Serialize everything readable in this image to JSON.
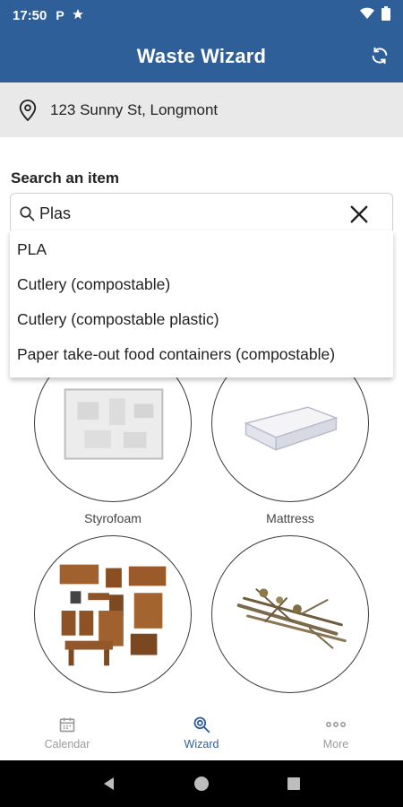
{
  "status_bar": {
    "time": "17:50",
    "icons": [
      "parking-icon",
      "star-icon",
      "wifi-icon",
      "battery-icon"
    ],
    "parking_glyph": "P"
  },
  "app_bar": {
    "title": "Waste Wizard",
    "refresh_icon": "refresh-icon"
  },
  "address": {
    "icon": "location-pin-icon",
    "text": "123 Sunny St, Longmont"
  },
  "search": {
    "label": "Search an item",
    "value": "Plas",
    "search_icon": "search-icon",
    "clear_icon": "close-icon",
    "suggestions": [
      "PLA",
      "Cutlery (compostable)",
      "Cutlery (compostable plastic)",
      "Paper take-out food containers (compostable)"
    ]
  },
  "items": [
    {
      "label": "Styrofoam",
      "image": "styrofoam-image"
    },
    {
      "label": "Mattress",
      "image": "mattress-image"
    },
    {
      "label": "",
      "image": "furniture-image"
    },
    {
      "label": "",
      "image": "branches-image"
    }
  ],
  "bottom_nav": [
    {
      "label": "Calendar",
      "icon": "calendar-icon",
      "active": false
    },
    {
      "label": "Wizard",
      "icon": "wizard-search-icon",
      "active": true
    },
    {
      "label": "More",
      "icon": "more-dots-icon",
      "active": false
    }
  ],
  "colors": {
    "primary": "#2f5f98",
    "address_bg": "#e9e9e9",
    "inactive_nav": "#9a9a9a"
  }
}
